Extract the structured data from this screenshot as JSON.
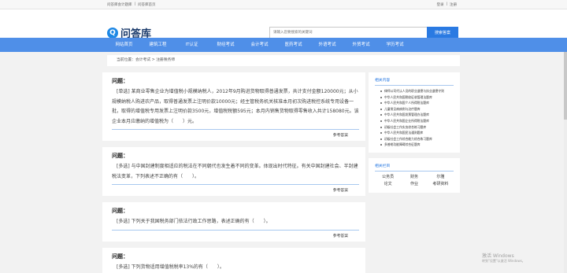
{
  "topbar": {
    "left_links": [
      "问答库会计题库",
      "|",
      "问答库首页"
    ],
    "right_links": [
      "登录",
      "|",
      "注册"
    ]
  },
  "header": {
    "logo_mark": "Q",
    "logo_text": "问答库",
    "search_placeholder": "请输入您要搜索的关键词",
    "search_button": "搜索答案"
  },
  "nav": {
    "items": [
      "网站首页",
      "建筑工程",
      "IT认证",
      "财经考试",
      "会计考试",
      "医药考试",
      "外语考试",
      "外贸考试",
      "学历考试"
    ]
  },
  "breadcrumb": "当前位置：会计考试 > 注册税务师",
  "questions": [
    {
      "heading": "问题：",
      "text": "[单选] 某商业零售企业为增值税小规模纳税人，2012年9月购进货物取得普通发票，共计支付金额120000元；从小规模纳税人购进农产品，取得普通发票上注明价款10000元；经主管税务机关核准本月初次购进税控系统专用设备一批，取得的增值税专用发票上注明价款3500元，增值税税额595元；本月内销售货物取得零售收入共计158080元。该企业本月应缴纳的增值税为（　　）元。",
      "answer_link": "参考答案"
    },
    {
      "heading": "问题：",
      "text": "[多选] 与中国封建制度相适应的税法在不同朝代也发生着不同的变革。体现出时代特征。有关中国封建社会、半封建税法变革，下列表述不正确的有（　　）。",
      "answer_link": "参考答案"
    },
    {
      "heading": "问题：",
      "text": "[多选] 下列关于我国税务部门依法行政工作思路，表述正确的有（　　）。",
      "answer_link": "参考答案"
    },
    {
      "heading": "问题：",
      "text": "[多选] 下列货物适用增值税税率13%的有（　　）。",
      "answer_link": "参考答案"
    }
  ],
  "sidebar": {
    "related_title": "相关内容",
    "related_items": [
      "律师公司代认人员的职业道德与执业道德守则",
      "中华人民共和国税收征收管理法题库",
      "中华人民共和国个人所得税法题库",
      "儿童常见病病例与治疗题库",
      "中华人民共和国发票管理办法题库",
      "中华人民共和国企业所得税法题库",
      "初级社会工作实务综合练习题库",
      "中华人民共和国民法通则题库",
      "初级社会工作综合能力综合练习题库",
      "多普勒功能障碍综合征题库"
    ],
    "recommend_title": "相关栏目",
    "recommend_items": [
      "公务员",
      "财务",
      "尔雅",
      "论文",
      "作业",
      "考研资料"
    ]
  },
  "watermark": {
    "title": "激活 Windows",
    "subtitle": "转到\"设置\"以激活 Windows。"
  }
}
